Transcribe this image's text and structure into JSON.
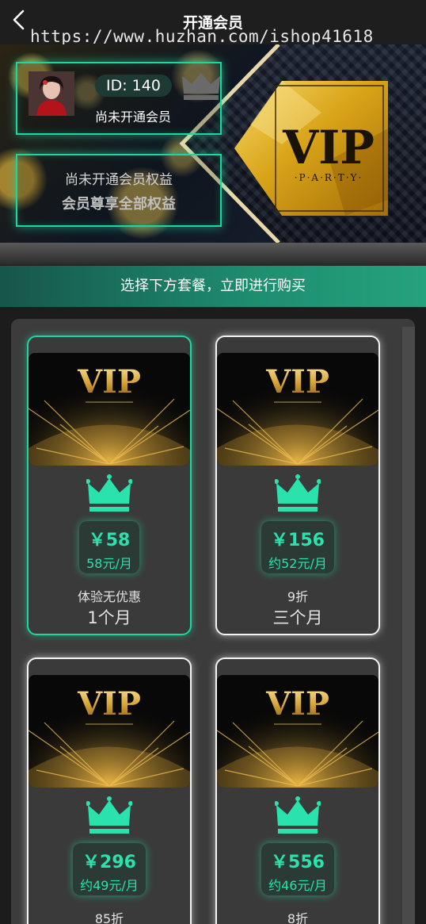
{
  "navbar": {
    "title": "开通会员",
    "back_icon": "chevron-left-icon",
    "watermark": "https://www.huzhan.com/ishop41618"
  },
  "banner": {
    "user_id": "ID: 140",
    "user_status": "尚未开通会员",
    "benefit_line1": "尚未开通会员权益",
    "benefit_line2": "会员尊享全部权益",
    "vip_logo_text": "VIP",
    "vip_logo_sub": "·P·A·R·T·Y·"
  },
  "instruction": "选择下方套餐，立即进行购买",
  "plans": [
    {
      "price": "￥58",
      "per_month": "58元/月",
      "discount": "体验无优惠",
      "duration": "1个月",
      "selected": true
    },
    {
      "price": "￥156",
      "per_month": "约52元/月",
      "discount": "9折",
      "duration": "三个月",
      "selected": false
    },
    {
      "price": "￥296",
      "per_month": "约49元/月",
      "discount": "85折",
      "duration": "",
      "selected": false
    },
    {
      "price": "￥556",
      "per_month": "约46元/月",
      "discount": "8折",
      "duration": "",
      "selected": false
    }
  ],
  "plan_image_text": "VIP",
  "colors": {
    "accent": "#1fd6a0",
    "price": "#29e2ac",
    "background": "#1c1c1c"
  }
}
